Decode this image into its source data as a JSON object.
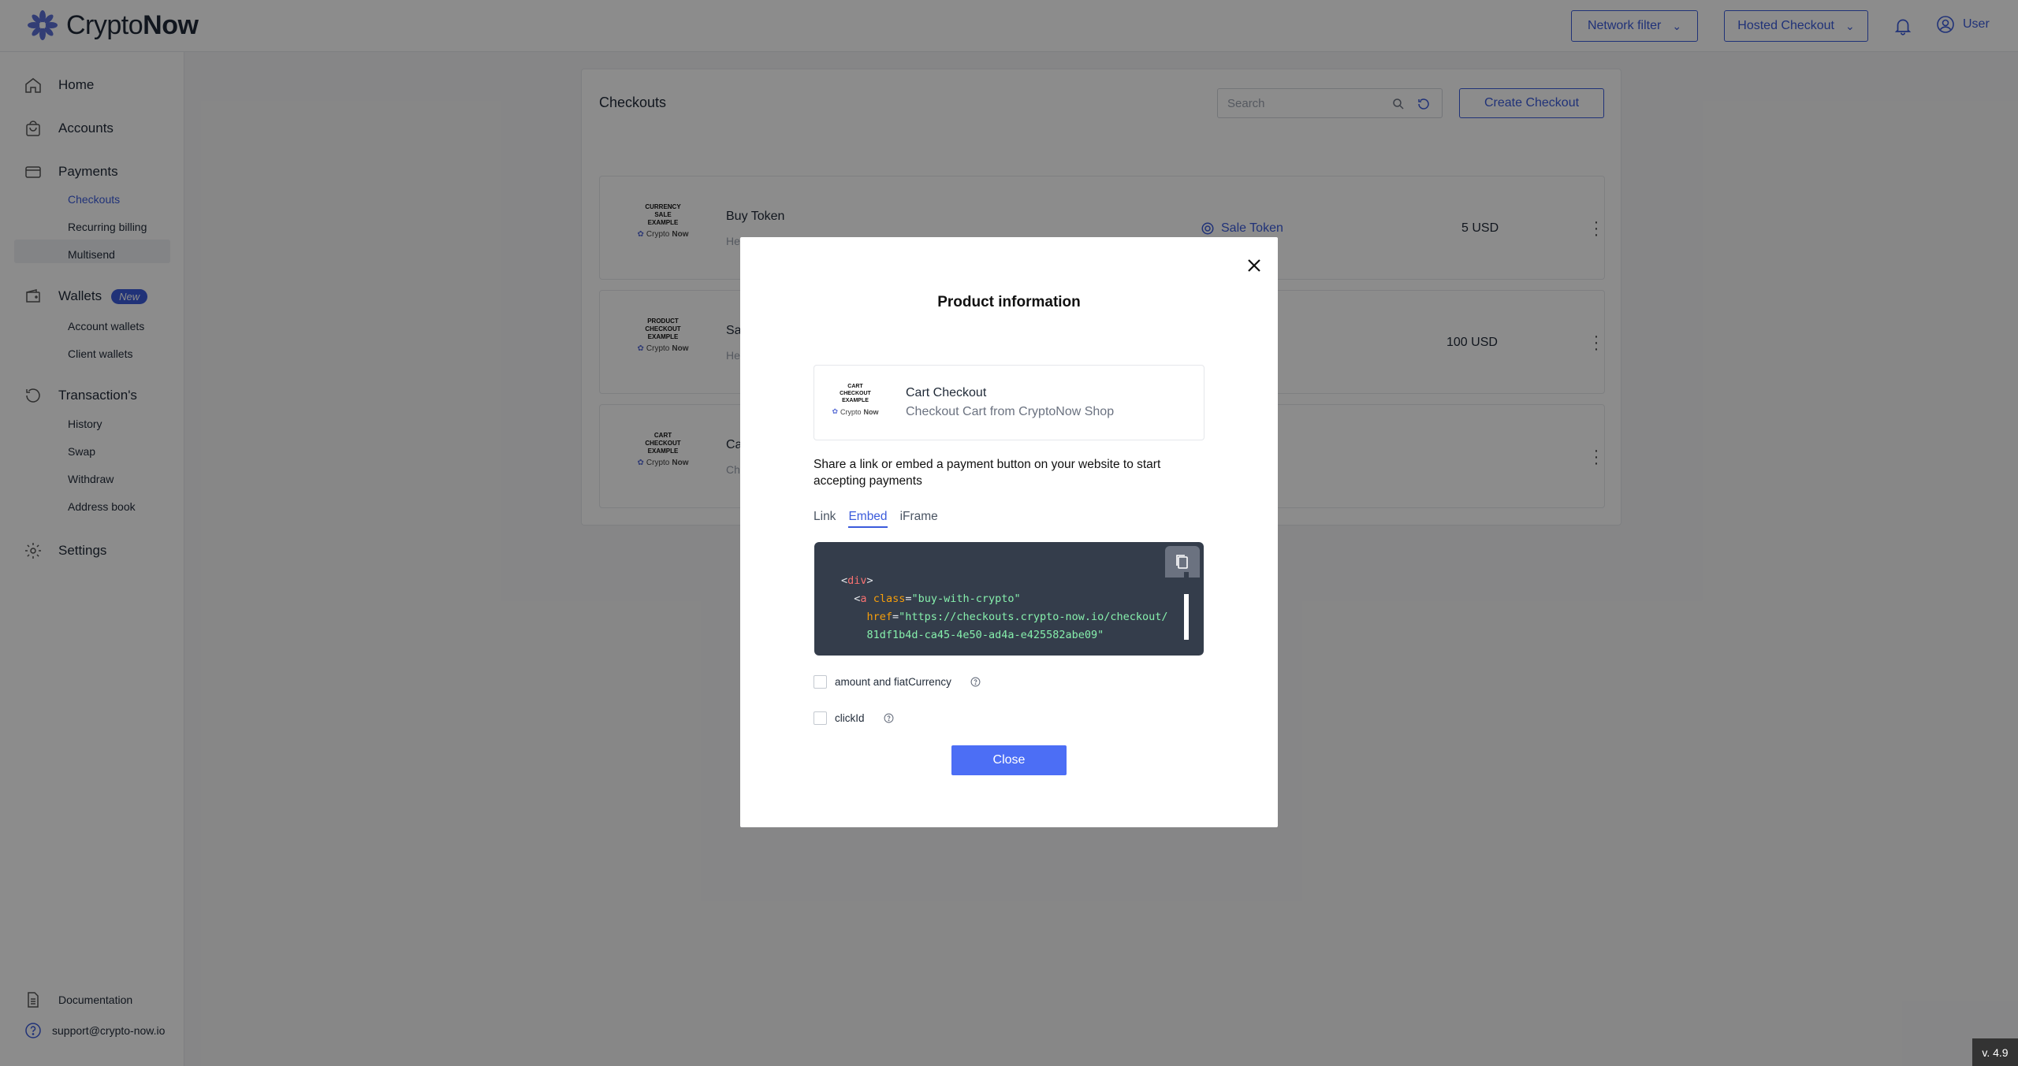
{
  "header": {
    "logo_light": "Crypto",
    "logo_bold": "Now",
    "network_filter": "Network filter",
    "hosted_checkout": "Hosted Checkout",
    "user": "User"
  },
  "sidebar": {
    "home": "Home",
    "accounts": "Accounts",
    "payments": "Payments",
    "checkouts": "Checkouts",
    "recurring_billing": "Recurring billing",
    "multisend": "Multisend",
    "wallets": "Wallets",
    "wallets_badge": "New",
    "account_wallets": "Account wallets",
    "client_wallets": "Client wallets",
    "transactions": "Transaction's",
    "history": "History",
    "swap": "Swap",
    "withdraw": "Withdraw",
    "address_book": "Address book",
    "settings": "Settings",
    "documentation": "Documentation",
    "support": "support@crypto-now.io"
  },
  "main": {
    "title": "Checkouts",
    "search_placeholder": "Search",
    "create_button": "Create Checkout",
    "rows": [
      {
        "thumb_line1": "CURRENCY",
        "thumb_line2": "SALE",
        "thumb_line3": "EXAMPLE",
        "name": "Buy Token",
        "sub": "He",
        "link": "Sale Token",
        "price": "5 USD"
      },
      {
        "thumb_line1": "PRODUCT",
        "thumb_line2": "CHECKOUT",
        "thumb_line3": "EXAMPLE",
        "name": "Sa",
        "sub": "He",
        "link": "",
        "price": "100 USD"
      },
      {
        "thumb_line1": "CART",
        "thumb_line2": "CHECKOUT",
        "thumb_line3": "EXAMPLE",
        "name": "Ca",
        "sub": "Ch",
        "link": "",
        "price": ""
      }
    ],
    "thumb_brand_light": "Crypto",
    "thumb_brand_bold": "Now"
  },
  "modal": {
    "title": "Product information",
    "product_thumb_line1": "CART",
    "product_thumb_line2": "CHECKOUT",
    "product_thumb_line3": "EXAMPLE",
    "product_name": "Cart Checkout",
    "product_desc": "Checkout Cart from CryptoNow Shop",
    "share_text": "Share a link or embed a payment button on your website to start accepting payments",
    "tabs": [
      "Link",
      "Embed",
      "iFrame"
    ],
    "code": {
      "line1_tag": "div",
      "line2_tag": "a",
      "line2_attr": "class",
      "line2_value": "\"buy-with-crypto\"",
      "line3_attr": "href",
      "line3_value": "\"https://checkouts.crypto-now.io/checkout/",
      "line4_value": "81df1b4d-ca45-4e50-ad4a-e425582abe09\""
    },
    "option1": "amount and fiatCurrency",
    "option2": "clickId",
    "close_button": "Close"
  },
  "version": "v. 4.9",
  "colors": {
    "accent": "#3b5bdb",
    "primary_button": "#4c6ef5",
    "code_bg": "#343d4b"
  }
}
